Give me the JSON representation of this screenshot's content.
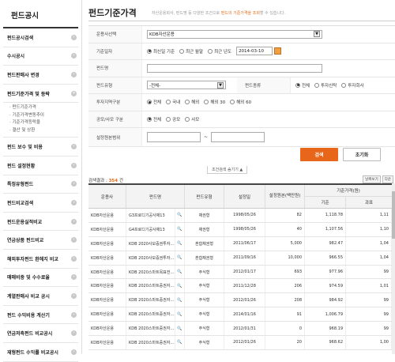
{
  "sidebar": {
    "title": "펀드공시",
    "items": [
      {
        "label": "펀드공시검색"
      },
      {
        "label": "수시공시"
      },
      {
        "label": "펀드판매사 변경"
      },
      {
        "label": "펀드기준가격 및 등락"
      },
      {
        "label": "펀드 보수 및 비용"
      },
      {
        "label": "펀드 설정현황"
      },
      {
        "label": "특정유형펀드"
      },
      {
        "label": "펀드비교검색"
      },
      {
        "label": "펀드운용실적비교"
      },
      {
        "label": "연금상품 펀드비교"
      },
      {
        "label": "해외투자펀드 환헤지 비교"
      },
      {
        "label": "매매비중 및 수수료율"
      },
      {
        "label": "계열판매사 비교 공시"
      },
      {
        "label": "펀드 수익비용 계산기"
      },
      {
        "label": "연금저축펀드 비교공시"
      },
      {
        "label": "재형펀드 수익률 비교공시"
      }
    ],
    "sub_items": [
      "펀드기준가격",
      "기준가격변동추이",
      "기준가격등락율",
      "결산 및 상환"
    ]
  },
  "page": {
    "title": "펀드기준가격",
    "desc_pre": "자산운용회사, 펀드명 등 다양한 조건으로 ",
    "desc_hl": "펀드의 기준가격을 조회",
    "desc_post": "할 수 있습니다."
  },
  "form": {
    "manager_label": "운용사선택",
    "manager_value": "KDB자산운용",
    "date_label": "기준일자",
    "date_opt1": "최신일 기준",
    "date_opt2": "최근 월말",
    "date_opt3": "최근 년도",
    "date_value": "2014-03-10",
    "fundname_label": "펀드명",
    "fundname_value": "",
    "fundtype_label": "펀드유형",
    "fundtype_value": "-전체-",
    "fundkind_label": "펀드종류",
    "kind_opt1": "전체",
    "kind_opt2": "투자신탁",
    "kind_opt3": "투자회사",
    "region_label": "투자지역구분",
    "region_opt1": "전체",
    "region_opt2": "국내",
    "region_opt3": "해외",
    "region_opt4": "해외 30",
    "region_opt5": "해외 60",
    "offer_label": "공모/사모 구분",
    "offer_opt1": "전체",
    "offer_opt2": "공모",
    "offer_opt3": "사모",
    "range_label": "설정원본범위",
    "range_sep": "~",
    "search_btn": "검색",
    "reset_btn": "초기화",
    "toggle_label": "조건검색 숨기기 ▲"
  },
  "results": {
    "count_prefix": "검색결과 : ",
    "count": "354",
    "count_suffix": " 건",
    "btn1": "날짜보기",
    "btn2": "다운"
  },
  "table": {
    "headers": {
      "manager": "운용사",
      "fund": "펀드명",
      "type": "펀드유형",
      "date": "설정일",
      "principal": "설정원본(백만원)",
      "price": "기준가격(원)",
      "price_sub1": "기준",
      "price_sub2": "과표"
    },
    "rows": [
      {
        "m": "KDB자산운용",
        "f": "G3프로디기공사채13",
        "t": "채권형",
        "d": "1998/05/26",
        "p": "82",
        "b": "1,118.78",
        "x": "1,11"
      },
      {
        "m": "KDB자산운용",
        "f": "G4프로디기공사채13",
        "t": "채권형",
        "d": "1998/05/26",
        "p": "40",
        "b": "1,107.56",
        "x": "1,10"
      },
      {
        "m": "KDB자산운용",
        "f": "KDB 2020사모증권투자...",
        "t": "혼합채권형",
        "d": "2011/06/17",
        "p": "5,000",
        "b": "982.47",
        "x": "1,04"
      },
      {
        "m": "KDB자산운용",
        "f": "KDB 2020사모증권투자...",
        "t": "혼합채권형",
        "d": "2011/09/16",
        "p": "10,000",
        "b": "966.55",
        "x": "1,04"
      },
      {
        "m": "KDB자산운용",
        "f": "KDB 2020스마트목표전...",
        "t": "주식형",
        "d": "2012/01/17",
        "p": "693",
        "b": "977.96",
        "x": "99"
      },
      {
        "m": "KDB자산운용",
        "f": "KDB 2020스마트증권자...",
        "t": "주식형",
        "d": "2011/12/28",
        "p": "206",
        "b": "974.59",
        "x": "1,01"
      },
      {
        "m": "KDB자산운용",
        "f": "KDB 2020스마트증권자...",
        "t": "주식형",
        "d": "2012/01/26",
        "p": "208",
        "b": "984.92",
        "x": "99"
      },
      {
        "m": "KDB자산운용",
        "f": "KDB 2020스마트증권자...",
        "t": "주식형",
        "d": "2014/01/16",
        "p": "91",
        "b": "1,006.79",
        "x": "99"
      },
      {
        "m": "KDB자산운용",
        "f": "KDB 2020스마트증권자...",
        "t": "주식형",
        "d": "2012/01/31",
        "p": "0",
        "b": "968.19",
        "x": "99"
      },
      {
        "m": "KDB자산운용",
        "f": "KDB 2020스마트증권자...",
        "t": "주식형",
        "d": "2012/01/26",
        "p": "20",
        "b": "968.62",
        "x": "1,00"
      }
    ]
  }
}
